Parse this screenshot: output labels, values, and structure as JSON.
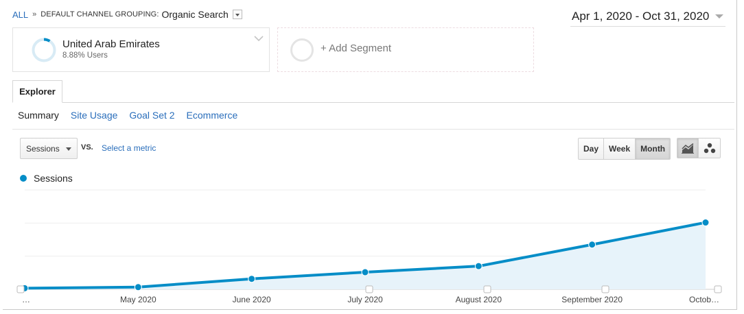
{
  "breadcrumb": {
    "all": "ALL",
    "separator": "»",
    "dimension_label": "DEFAULT CHANNEL GROUPING:",
    "dimension_value": "Organic Search"
  },
  "date_range": "Apr 1, 2020 - Oct 31, 2020",
  "segment": {
    "name": "United Arab Emirates",
    "share": "8.88% Users",
    "share_fraction": 0.0888,
    "color": "#058dc7"
  },
  "add_segment": "+ Add Segment",
  "tabs": {
    "explorer": "Explorer"
  },
  "subtabs": [
    "Summary",
    "Site Usage",
    "Goal Set 2",
    "Ecommerce"
  ],
  "controls": {
    "metric": "Sessions",
    "vs": "VS.",
    "select_metric": "Select a metric",
    "periods": [
      "Day",
      "Week",
      "Month"
    ],
    "active_period": "Month",
    "chart_types": [
      "line-chart-icon",
      "motion-chart-icon"
    ]
  },
  "legend": {
    "label": "Sessions",
    "color": "#058dc7"
  },
  "chart_data": {
    "type": "area",
    "categories": [
      "…",
      "May 2020",
      "June 2020",
      "July 2020",
      "August 2020",
      "September 2020",
      "Octob…"
    ],
    "series": [
      {
        "name": "Sessions",
        "values": [
          2,
          4,
          19,
          31,
          42,
          81,
          121
        ],
        "color": "#058dc7"
      }
    ],
    "ylim": [
      0,
      180
    ],
    "grid": true,
    "legend": "top-left"
  }
}
